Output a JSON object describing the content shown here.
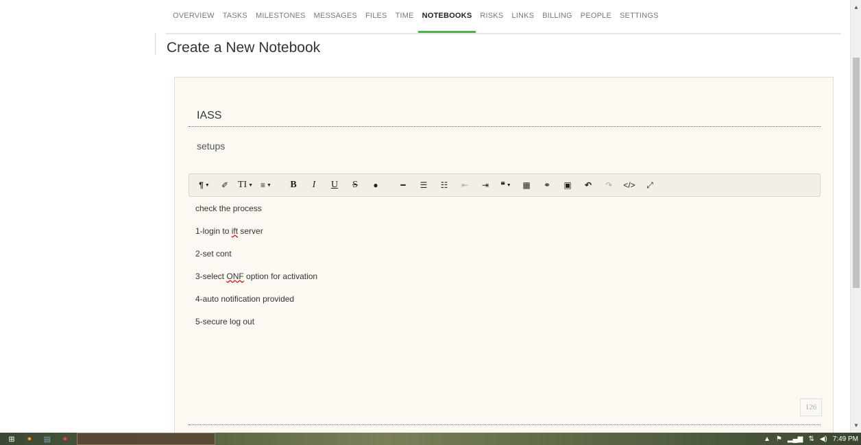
{
  "tabs": [
    {
      "label": "OVERVIEW",
      "active": false
    },
    {
      "label": "TASKS",
      "active": false
    },
    {
      "label": "MILESTONES",
      "active": false
    },
    {
      "label": "MESSAGES",
      "active": false
    },
    {
      "label": "FILES",
      "active": false
    },
    {
      "label": "TIME",
      "active": false
    },
    {
      "label": "NOTEBOOKS",
      "active": true
    },
    {
      "label": "RISKS",
      "active": false
    },
    {
      "label": "LINKS",
      "active": false
    },
    {
      "label": "BILLING",
      "active": false
    },
    {
      "label": "PEOPLE",
      "active": false
    },
    {
      "label": "SETTINGS",
      "active": false
    }
  ],
  "page_title": "Create a New Notebook",
  "form": {
    "title_value": "IASS",
    "description_value": "setups"
  },
  "toolbar": {
    "paragraph": "¶",
    "eraser": "✐",
    "font_size": "TI",
    "align": "≡",
    "bold": "B",
    "italic": "I",
    "underline": "U",
    "strike": "S",
    "color": "●",
    "hr": "━",
    "ordered_list": "☰",
    "unordered_list": "☷",
    "outdent": "⇤",
    "indent": "⇥",
    "quote": "❝",
    "table": "▦",
    "link": "⚭",
    "image": "▣",
    "undo": "↶",
    "redo": "↷",
    "code": "</>",
    "fullscreen": "⤢"
  },
  "editor": {
    "lines": [
      "check the process",
      {
        "pre": "1-login to ",
        "spell": "ift",
        "post": " server"
      },
      "2-set cont",
      {
        "pre": "3-select ",
        "spell": "ONF",
        "post": " option for activation"
      },
      "4-auto notification provided",
      "5-secure log out"
    ],
    "char_count": "126"
  },
  "taskbar": {
    "clock": "7:49 PM"
  },
  "colors": {
    "active_tab_underline": "#4caf50",
    "card_background": "#fbf9f1"
  }
}
